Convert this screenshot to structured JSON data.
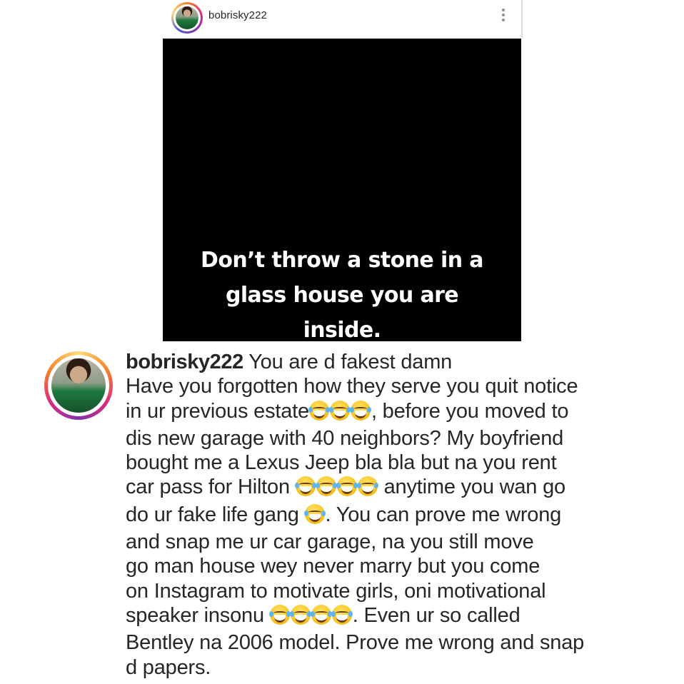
{
  "post": {
    "username": "bobrisky222",
    "quote": "Don’t throw a stone in a glass house you are inside."
  },
  "comment": {
    "username": "bobrisky222",
    "lines": [
      " You are d fakest damn",
      "Have you forgotten how they serve you quit notice",
      "in ur previous estate",
      ", before you moved to",
      "dis new garage with 40 neighbors? My boyfriend",
      "bought me a Lexus Jeep bla bla but na you rent",
      "car pass for Hilton ",
      " anytime you wan go",
      "do ur fake life gang ",
      ". You can prove me wrong",
      "and snap me ur car garage, na you still move",
      "go man house wey never marry but you come",
      "on Instagram to motivate girls, oni motivational",
      "speaker insonu ",
      ". Even ur so called",
      "Bentley na 2006 model. Prove me wrong and snap",
      "d papers."
    ]
  },
  "icons": {
    "more": "more-vertical-icon",
    "emoji": "face-with-tears-of-joy-emoji"
  }
}
